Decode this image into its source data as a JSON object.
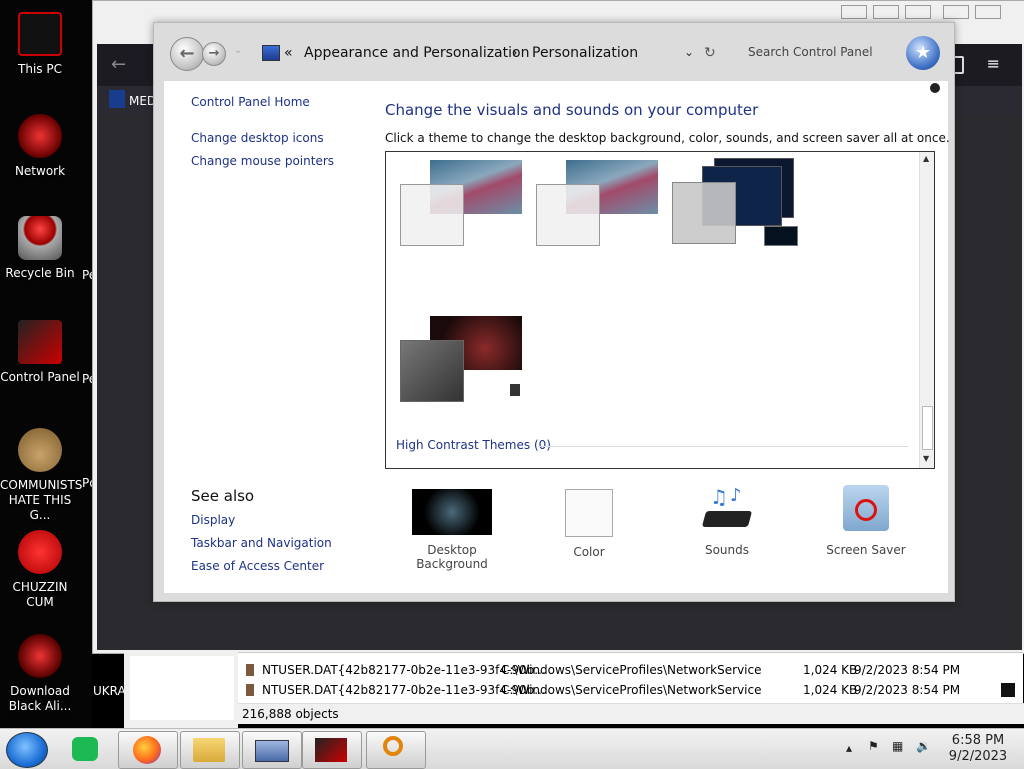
{
  "desktop": {
    "icons": [
      {
        "label": "This PC"
      },
      {
        "label": "Network"
      },
      {
        "label": "Recycle Bin"
      },
      {
        "label": "Control Panel"
      },
      {
        "label": "COMMUNISTS HATE THIS G..."
      },
      {
        "label": "CHUZZIN CUM"
      },
      {
        "label": "Download Black Ali..."
      }
    ],
    "partial_labels": [
      "Pe",
      "Pe",
      "Pc",
      "UKRA"
    ]
  },
  "browser": {
    "bookmark_label": "MED"
  },
  "explorer": {
    "rows": [
      {
        "name": "NTUSER.DAT{42b82177-0b2e-11e3-93f4-90b...",
        "path": "C:\\Windows\\ServiceProfiles\\NetworkService",
        "size": "1,024 KB",
        "date": "9/2/2023 8:54 PM"
      },
      {
        "name": "NTUSER.DAT{42b82177-0b2e-11e3-93f4-90b...",
        "path": "C:\\Windows\\ServiceProfiles\\NetworkService",
        "size": "1,024 KB",
        "date": "9/2/2023 8:54 PM"
      }
    ],
    "status": "216,888 objects"
  },
  "control_panel": {
    "breadcrumb": {
      "overflow": "«",
      "level1": "Appearance and Personalization",
      "separator": "›",
      "level2": "Personalization"
    },
    "search": {
      "placeholder": "Search Control Panel"
    },
    "sidebar": {
      "home": "Control Panel Home",
      "links": [
        "Change desktop icons",
        "Change mouse pointers"
      ],
      "see_also_title": "See also",
      "see_also": [
        "Display",
        "Taskbar and Navigation",
        "Ease of Access Center"
      ]
    },
    "main": {
      "heading": "Change the visuals and sounds on your computer",
      "subtitle": "Click a theme to change the desktop background, color, sounds, and screen saver all at once.",
      "high_contrast": "High Contrast Themes (0)"
    },
    "bottom_items": [
      {
        "label": "Desktop Background"
      },
      {
        "label": "Color"
      },
      {
        "label": "Sounds"
      },
      {
        "label": "Screen Saver"
      }
    ]
  },
  "taskbar": {
    "clock_time": "6:58 PM",
    "clock_date": "9/2/2023"
  }
}
